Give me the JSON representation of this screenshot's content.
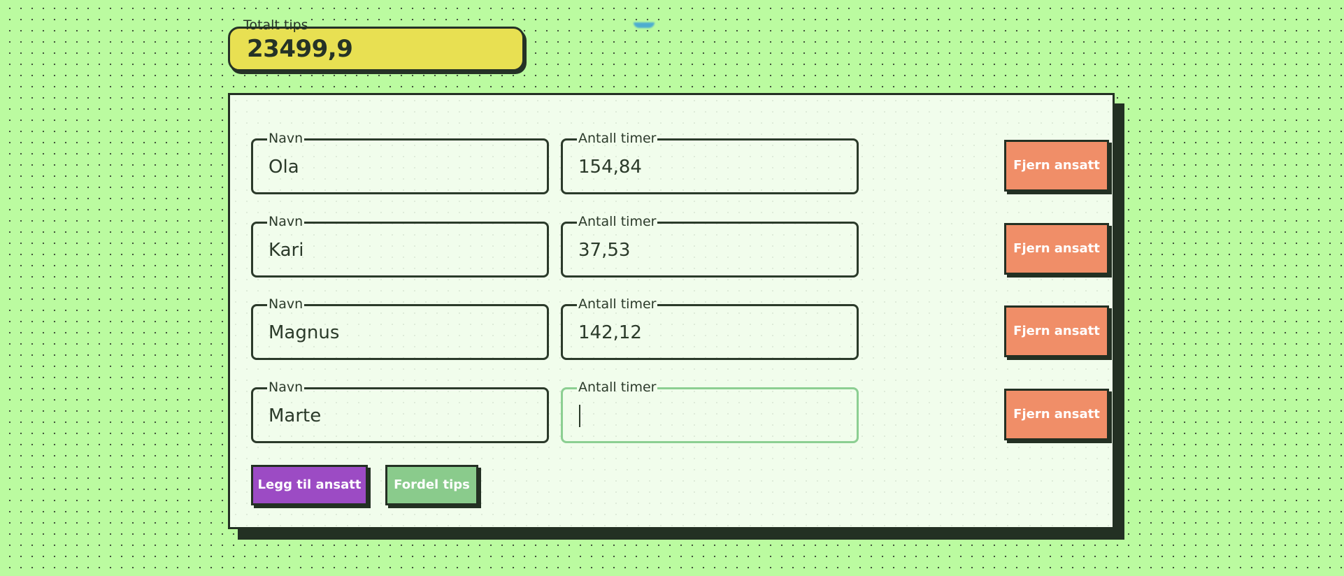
{
  "total_tips": {
    "label": "Totalt tips",
    "value": "23499,9"
  },
  "employees": [
    {
      "name_label": "Navn",
      "name": "Ola",
      "hours_label": "Antall timer",
      "hours": "154,84",
      "remove_label": "Fjern ansatt"
    },
    {
      "name_label": "Navn",
      "name": "Kari",
      "hours_label": "Antall timer",
      "hours": "37,53",
      "remove_label": "Fjern ansatt"
    },
    {
      "name_label": "Navn",
      "name": "Magnus",
      "hours_label": "Antall timer",
      "hours": "142,12",
      "remove_label": "Fjern ansatt"
    },
    {
      "name_label": "Navn",
      "name": "Marte",
      "hours_label": "Antall timer",
      "hours": "",
      "remove_label": "Fjern ansatt"
    }
  ],
  "actions": {
    "add_label": "Legg til ansatt",
    "distribute_label": "Fordel tips"
  },
  "colors": {
    "background": "#bbfba0",
    "total_field": "#e8e052",
    "card": "#f1fdec",
    "remove_button": "#f08e68",
    "add_button": "#9c4bc4",
    "distribute_button": "#8acb8c",
    "focused_border": "#8ccf92",
    "ink": "#233023"
  }
}
